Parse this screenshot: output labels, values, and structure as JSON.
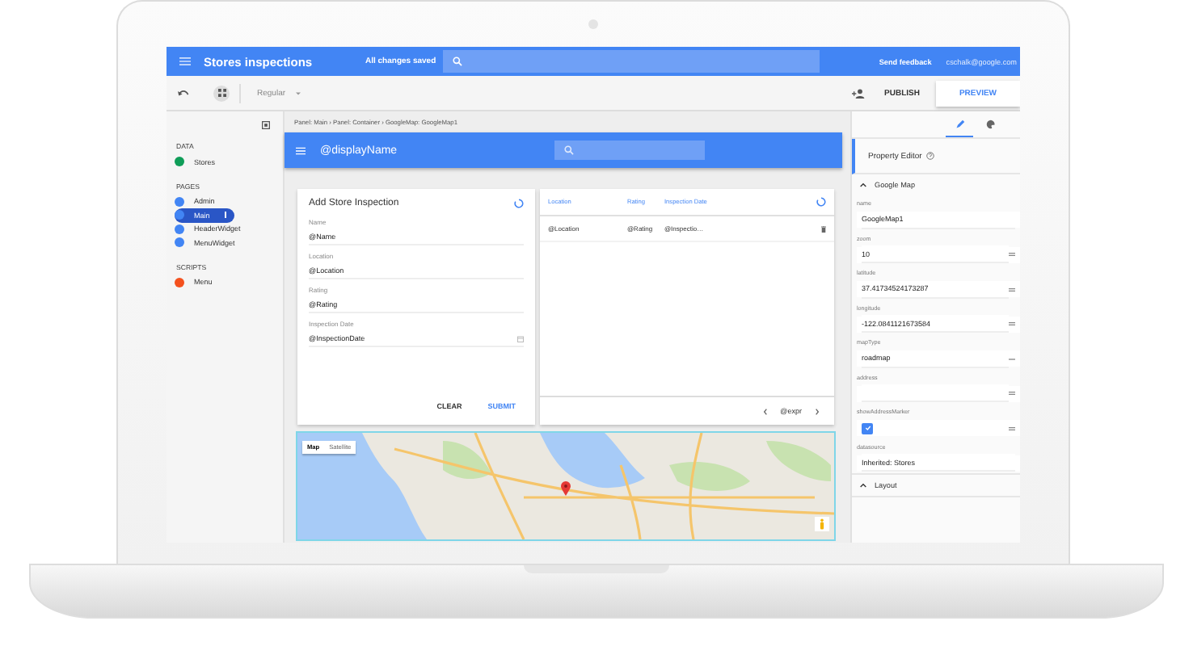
{
  "app_bar": {
    "title": "Stores inspections",
    "save_status": "All changes saved",
    "feedback": "Send feedback",
    "account": "cschalk@google.com"
  },
  "toolbar": {
    "style_select": "Regular",
    "publish": "PUBLISH",
    "preview": "PREVIEW"
  },
  "sidebar": {
    "sections": [
      {
        "title": "DATA",
        "items": [
          {
            "label": "Stores",
            "color": "#0f9d58",
            "selected": false
          }
        ]
      },
      {
        "title": "PAGES",
        "items": [
          {
            "label": "Admin",
            "color": "#4285f4",
            "selected": false
          },
          {
            "label": "Main",
            "color": "#4285f4",
            "selected": true
          },
          {
            "label": "HeaderWidget",
            "color": "#4285f4",
            "selected": false
          },
          {
            "label": "MenuWidget",
            "color": "#4285f4",
            "selected": false
          }
        ]
      },
      {
        "title": "SCRIPTS",
        "items": [
          {
            "label": "Menu",
            "color": "#f4511e",
            "selected": false
          }
        ]
      }
    ]
  },
  "breadcrumb": "Panel: Main › Panel: Container › GoogleMap: GoogleMap1",
  "page_header": {
    "title": "@displayName"
  },
  "form": {
    "title": "Add Store Inspection",
    "fields": [
      {
        "label": "Name",
        "value": "@Name",
        "kind": "text"
      },
      {
        "label": "Location",
        "value": "@Location",
        "kind": "text"
      },
      {
        "label": "Rating",
        "value": "@Rating",
        "kind": "text"
      },
      {
        "label": "Inspection Date",
        "value": "@InspectionDate",
        "kind": "date"
      }
    ],
    "buttons": [
      {
        "label": "CLEAR",
        "primary": false
      },
      {
        "label": "SUBMIT",
        "primary": true
      }
    ]
  },
  "table": {
    "columns": [
      "Location",
      "Rating",
      "Inspection Date"
    ],
    "rows": [
      [
        "@Location",
        "@Rating",
        "@Inspectio…"
      ]
    ],
    "pager": "@expr"
  },
  "map": {
    "type_buttons": [
      {
        "label": "Map",
        "selected": true
      },
      {
        "label": "Satellite",
        "selected": false
      }
    ]
  },
  "property_editor": {
    "tabs": [
      {
        "selected": true
      },
      {
        "selected": false
      }
    ],
    "title": "Property Editor",
    "sections": [
      {
        "title": "Google Map",
        "properties": [
          {
            "label": "name",
            "value": "GoogleMap1",
            "kind": "text",
            "binding": false,
            "menu": false
          },
          {
            "label": "zoom",
            "value": "10",
            "kind": "text",
            "binding": true,
            "menu": false
          },
          {
            "label": "latitude",
            "value": "37.41734524173287",
            "kind": "text",
            "binding": true,
            "menu": false
          },
          {
            "label": "longitude",
            "value": "-122.0841121673584",
            "kind": "text",
            "binding": true,
            "menu": false
          },
          {
            "label": "mapType",
            "value": "roadmap",
            "kind": "text",
            "binding": false,
            "menu": true
          },
          {
            "label": "address",
            "kind": "text",
            "binding": true,
            "menu": false
          },
          {
            "label": "showAddressMarker",
            "kind": "checkbox",
            "checked": true,
            "binding": true,
            "menu": false
          },
          {
            "label": "datasource",
            "value": "Inherited: Stores",
            "kind": "text",
            "binding": false,
            "menu": false
          }
        ]
      },
      {
        "title": "Layout"
      }
    ]
  }
}
